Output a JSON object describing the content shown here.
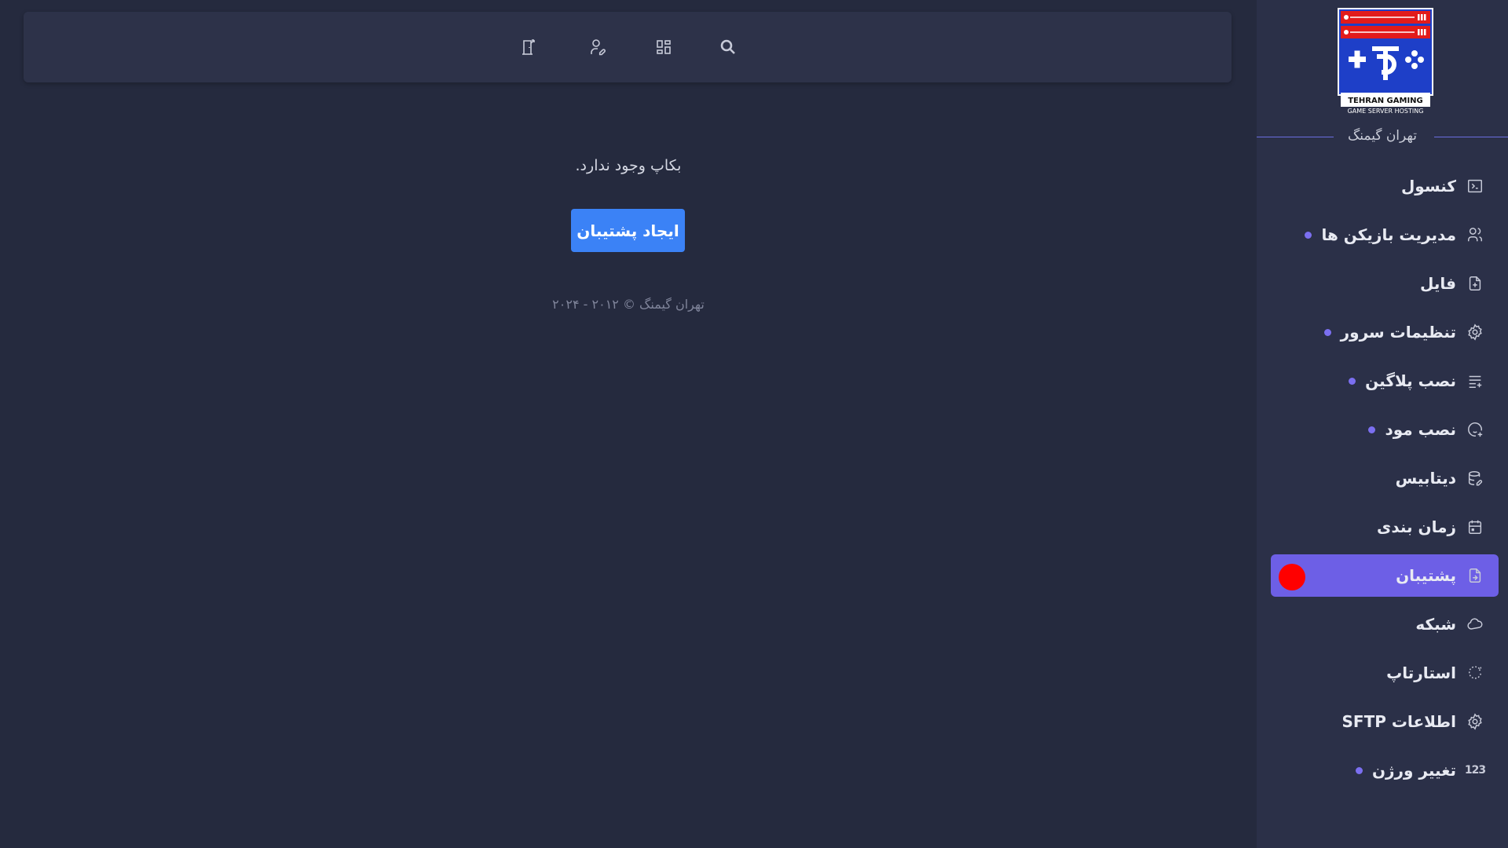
{
  "brand": {
    "name": "تهران گیمنگ",
    "logo_title": "TEHRAN GAMING",
    "logo_subtitle": "GAME SERVER HOSTING",
    "logo_monogram": "TG"
  },
  "colors": {
    "background": "#252a3e",
    "sidebar": "#2b3048",
    "accent": "#6d5fe6",
    "button": "#3b82f6",
    "indicator_dot": "#7b6ff0",
    "active_marker": "#ff0000"
  },
  "topbar": {
    "icons": [
      "search-icon",
      "dashboard-icon",
      "user-edit-icon",
      "logout-icon"
    ]
  },
  "sidebar": {
    "items": [
      {
        "label": "کنسول",
        "icon": "terminal-icon",
        "dot": false
      },
      {
        "label": "مدیریت بازیکن ها",
        "icon": "users-icon",
        "dot": true
      },
      {
        "label": "فایل",
        "icon": "file-icon",
        "dot": false
      },
      {
        "label": "تنظیمات سرور",
        "icon": "gear-icon",
        "dot": true
      },
      {
        "label": "نصب پلاگین",
        "icon": "playlist-add-icon",
        "dot": true
      },
      {
        "label": "نصب مود",
        "icon": "mood-add-icon",
        "dot": true
      },
      {
        "label": "دیتابیس",
        "icon": "database-icon",
        "dot": false
      },
      {
        "label": "زمان بندی",
        "icon": "calendar-icon",
        "dot": false
      },
      {
        "label": "پشتیبان",
        "icon": "backup-file-icon",
        "dot": false,
        "active": true
      },
      {
        "label": "شبکه",
        "icon": "cloud-icon",
        "dot": false
      },
      {
        "label": "استارتاپ",
        "icon": "reload-icon",
        "dot": false
      },
      {
        "label": "اطلاعات SFTP",
        "icon": "gear-icon",
        "dot": false
      },
      {
        "label": "تغییر ورژن",
        "icon": "numbers-icon",
        "icon_text": "123",
        "dot": true
      }
    ]
  },
  "main": {
    "empty_message": "بکاپ وجود ندارد.",
    "create_button": "ایجاد پشتیبان",
    "footer": "تهران گیمنگ © ۲۰۱۲ - ۲۰۲۴"
  }
}
